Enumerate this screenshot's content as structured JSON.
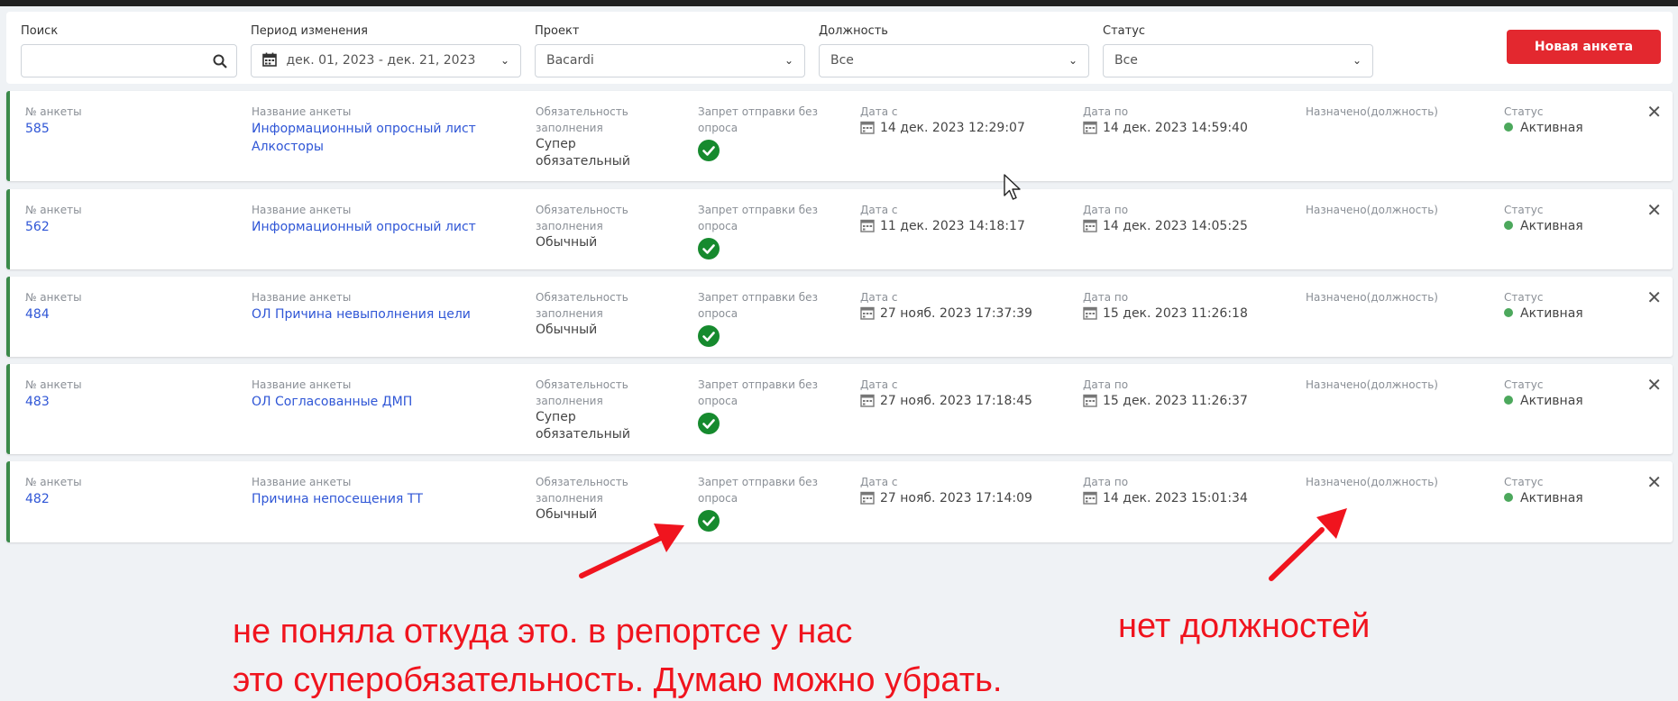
{
  "filters": {
    "search": {
      "label": "Поиск",
      "value": "",
      "icon": "search-icon"
    },
    "period": {
      "label": "Период изменения",
      "value": "дек. 01, 2023 - дек. 21, 2023"
    },
    "project": {
      "label": "Проект",
      "value": "Bacardi"
    },
    "position": {
      "label": "Должность",
      "value": "Все"
    },
    "status": {
      "label": "Статус",
      "value": "Все"
    },
    "new_button": "Новая анкета"
  },
  "labels": {
    "number": "№ анкеты",
    "name": "Название анкеты",
    "mandatory": "Обязательность заполнения",
    "ban": "Запрет отправки без опроса",
    "date_from": "Дата с",
    "date_to": "Дата по",
    "assigned": "Назначено(должность)",
    "status": "Статус"
  },
  "rows": [
    {
      "number": "585",
      "name": "Информационный опросный лист Алкосторы",
      "mandatory": "Супер обязательный",
      "date_from": "14 дек. 2023 12:29:07",
      "date_to": "14 дек. 2023 14:59:40",
      "assigned": "",
      "status": "Активная"
    },
    {
      "number": "562",
      "name": "Информационный опросный лист",
      "mandatory": "Обычный",
      "date_from": "11 дек. 2023 14:18:17",
      "date_to": "14 дек. 2023 14:05:25",
      "assigned": "",
      "status": "Активная"
    },
    {
      "number": "484",
      "name": "ОЛ Причина невыполнения цели",
      "mandatory": "Обычный",
      "date_from": "27 нояб. 2023 17:37:39",
      "date_to": "15 дек. 2023 11:26:18",
      "assigned": "",
      "status": "Активная"
    },
    {
      "number": "483",
      "name": "ОЛ Согласованные ДМП",
      "mandatory": "Супер обязательный",
      "date_from": "27 нояб. 2023 17:18:45",
      "date_to": "15 дек. 2023 11:26:37",
      "assigned": "",
      "status": "Активная"
    },
    {
      "number": "482",
      "name": "Причина непосещения ТТ",
      "mandatory": "Обычный",
      "date_from": "27 нояб. 2023 17:14:09",
      "date_to": "14 дек. 2023 15:01:34",
      "assigned": "",
      "status": "Активная"
    }
  ],
  "annotations": {
    "note_left_line1": "не поняла откуда это. в репортсе у нас",
    "note_left_line2": "это суперобязательность. Думаю можно убрать.",
    "note_right": "нет должностей"
  },
  "colors": {
    "accent": "#e3282f",
    "link": "#2f56d6",
    "status_active": "#4ca85c",
    "annotation": "#f0141e"
  }
}
